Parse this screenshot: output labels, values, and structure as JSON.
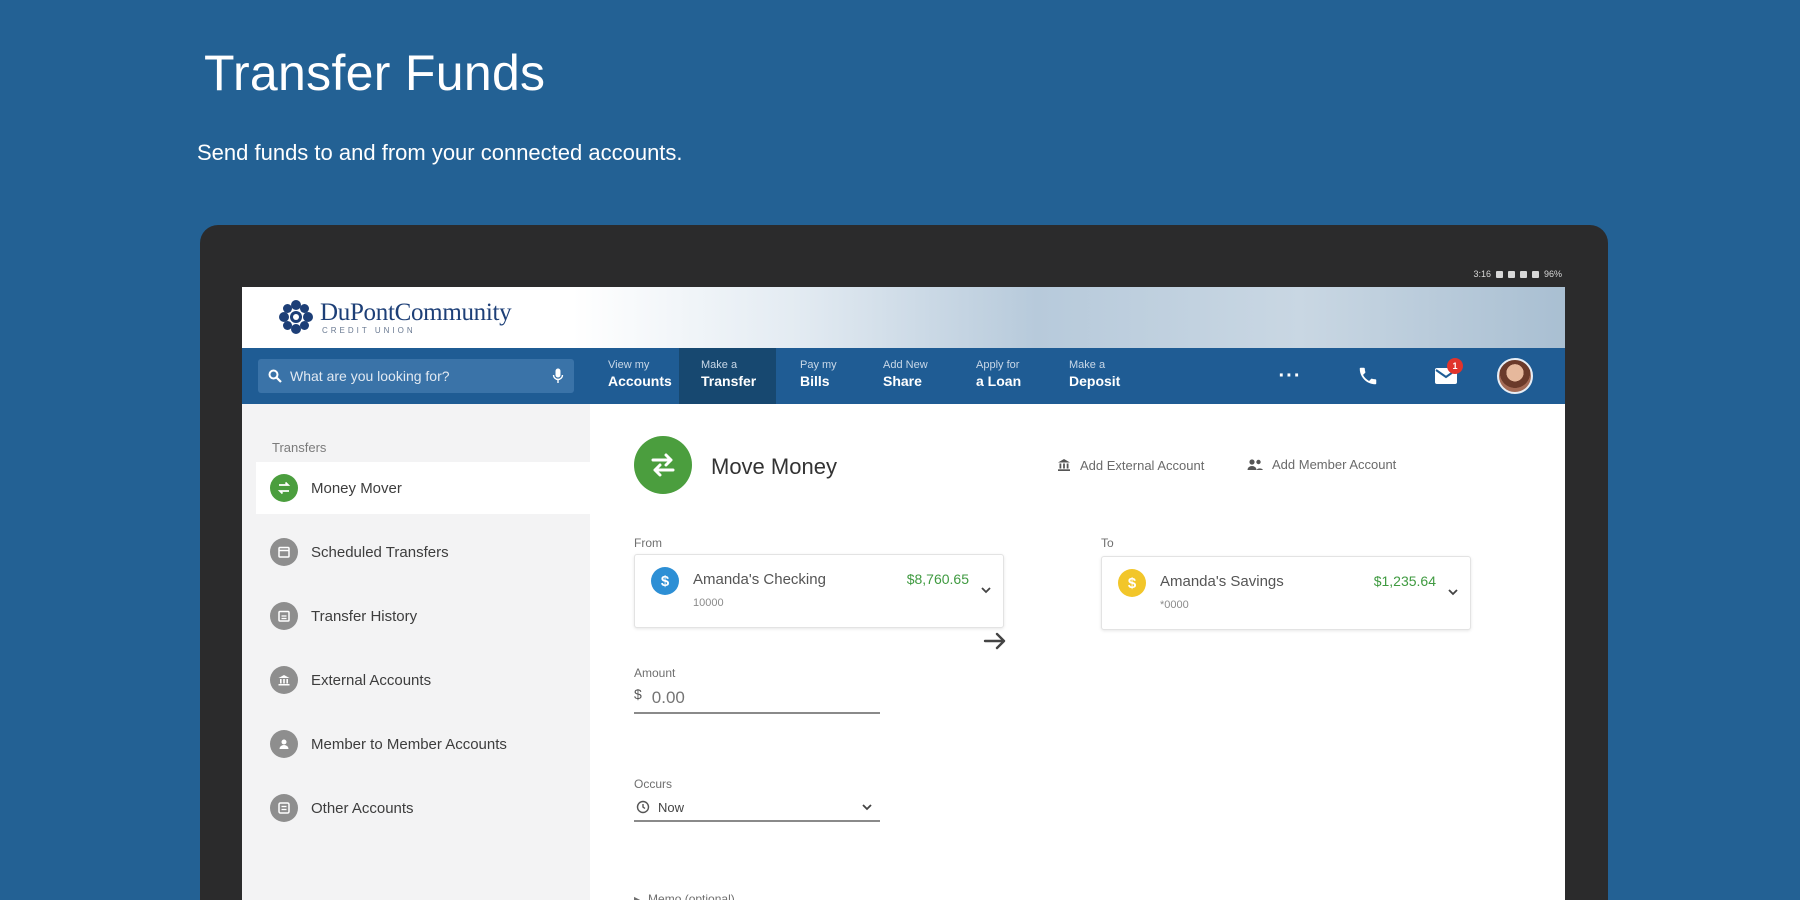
{
  "hero": {
    "title": "Transfer Funds",
    "subtitle": "Send funds to and from your connected accounts."
  },
  "statusbar": {
    "time": "3:16",
    "battery": "96%"
  },
  "brand": {
    "name_a": "DuPont",
    "name_b": "Community",
    "tagline": "CREDIT UNION"
  },
  "search": {
    "placeholder": "What are you looking for?"
  },
  "nav": {
    "items": [
      {
        "small": "View my",
        "big": "Accounts"
      },
      {
        "small": "Make a",
        "big": "Transfer"
      },
      {
        "small": "Pay my",
        "big": "Bills"
      },
      {
        "small": "Add New",
        "big": "Share"
      },
      {
        "small": "Apply for",
        "big": "a Loan"
      },
      {
        "small": "Make a",
        "big": "Deposit"
      }
    ],
    "more": "···",
    "mail_badge": "1"
  },
  "sidebar": {
    "heading": "Transfers",
    "items": [
      {
        "label": "Money Mover",
        "icon": "swap-icon"
      },
      {
        "label": "Scheduled Transfers",
        "icon": "calendar-icon"
      },
      {
        "label": "Transfer History",
        "icon": "history-icon"
      },
      {
        "label": "External Accounts",
        "icon": "bank-icon"
      },
      {
        "label": "Member to Member Accounts",
        "icon": "people-icon"
      },
      {
        "label": "Other Accounts",
        "icon": "accounts-icon"
      }
    ]
  },
  "main": {
    "title": "Move Money",
    "add_external": "Add External Account",
    "add_member": "Add Member Account",
    "from_label": "From",
    "to_label": "To",
    "from": {
      "name": "Amanda's Checking",
      "number": "10000",
      "balance": "$8,760.65"
    },
    "to": {
      "name": "Amanda's Savings",
      "number": "*0000",
      "balance": "$1,235.64"
    },
    "amount_label": "Amount",
    "currency": "$",
    "amount_placeholder": "0.00",
    "occurs_label": "Occurs",
    "occurs_value": "Now",
    "memo": "Memo (optional)"
  },
  "colors": {
    "page_bg": "#236194",
    "nav_bg": "#1f5c94",
    "accent_green": "#4b9e3e",
    "balance_green": "#3f9a40",
    "checking_icon": "#2d8fd5",
    "savings_icon": "#f2c62a"
  }
}
